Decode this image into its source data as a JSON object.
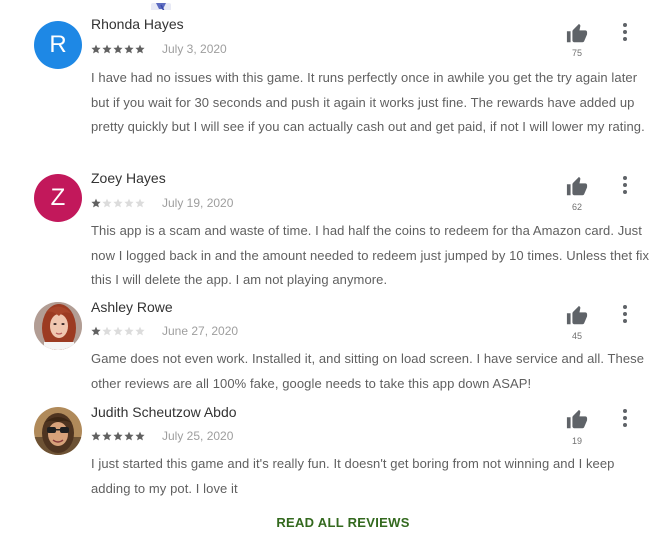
{
  "reviews": [
    {
      "name": "Rhonda Hayes",
      "avatar_letter": "R",
      "avatar_color": "#1e88e5",
      "rating": 5,
      "date": "July 3, 2020",
      "helpful_count": "75",
      "text": "I have had no issues with this game. It runs perfectly once in awhile you get the try again later but if you wait for 30 seconds and push it again it works just fine. The rewards have added up pretty quickly but I will see if you can actually cash out and get paid, if not I will lower my rating."
    },
    {
      "name": "Zoey Hayes",
      "avatar_letter": "Z",
      "avatar_color": "#c2185b",
      "rating": 1,
      "date": "July 19, 2020",
      "helpful_count": "62",
      "text": "This app is a scam and waste of time. I had half the coins to redeem for tha Amazon card. Just now I logged back in and the amount needed to redeem just jumped by 10 times. Unless thet fix this I will delete the app. I am not playing anymore."
    },
    {
      "name": "Ashley Rowe",
      "rating": 1,
      "date": "June 27, 2020",
      "helpful_count": "45",
      "text": "Game does not even work. Installed it, and sitting on load screen. I have service and all. These other reviews are all 100% fake, google needs to take this app down ASAP!"
    },
    {
      "name": "Judith Scheutzow Abdo",
      "rating": 5,
      "date": "July 25, 2020",
      "helpful_count": "19",
      "text": "I just started this game and it's really fun. It doesn't get boring from not winning and I keep adding to my pot. I love it"
    }
  ],
  "read_all_label": "READ ALL REVIEWS",
  "colors": {
    "star_filled": "#616161",
    "star_empty": "#dcdcdc",
    "link_green": "#33691e",
    "icon_gray": "#5f6368"
  },
  "icons": {
    "helpful": "thumb-up-icon",
    "more": "more-vert-icon",
    "star": "star-icon"
  }
}
